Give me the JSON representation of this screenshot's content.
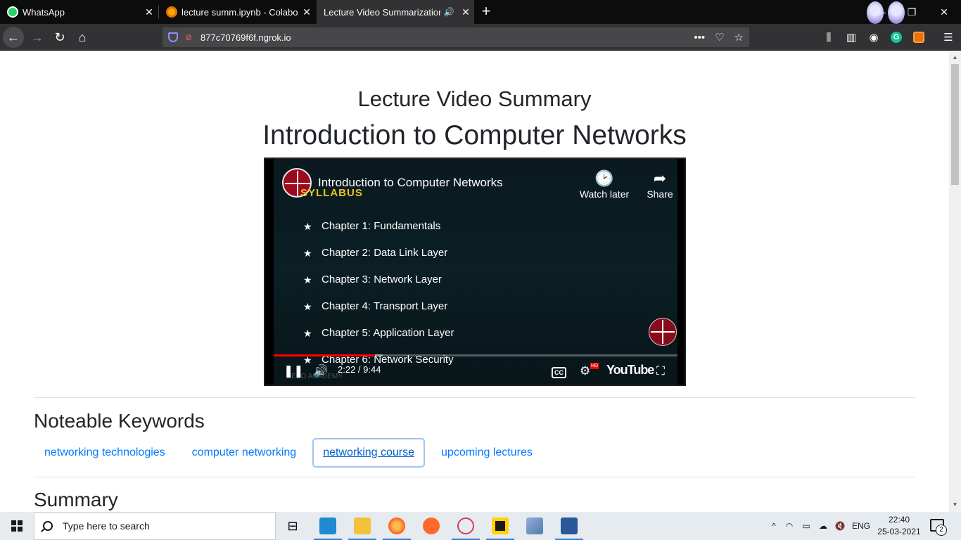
{
  "browser": {
    "tabs": [
      {
        "label": "WhatsApp",
        "icon": "whatsapp-icon"
      },
      {
        "label": "lecture summ.ipynb - Colabora",
        "icon": "colab-icon"
      },
      {
        "label": "Lecture Video Summarization",
        "icon": "speaker-icon",
        "active": true
      }
    ],
    "url": "877c70769f6f.ngrok.io"
  },
  "page": {
    "subtitle": "Lecture Video Summary",
    "title": "Introduction to Computer Networks",
    "video": {
      "title": "Introduction to Computer Networks",
      "watch_later": "Watch later",
      "share": "Share",
      "syllabus": "SYLLABUS",
      "chapters": [
        "Chapter 1:  Fundamentals",
        "Chapter 2: Data Link Layer",
        "Chapter 3: Network Layer",
        "Chapter 4: Transport Layer",
        "Chapter 5: Application Layer",
        "Chapter 6: Network Security"
      ],
      "time": "2:22 / 9:44",
      "progress": 0.251,
      "buffered": 0.27,
      "platform": "YouTube",
      "cc": "CC",
      "hd_badge": "HD",
      "watermark": "NESO ACADEMY"
    },
    "keywords_heading": "Noteable Keywords",
    "keywords": [
      "networking technologies",
      "computer networking",
      "networking course",
      "upcoming lectures"
    ],
    "summary_heading": "Summary"
  },
  "taskbar": {
    "search_placeholder": "Type here to search",
    "language": "ENG",
    "time": "22:40",
    "date": "25-03-2021",
    "notifications": "2"
  },
  "colors": {
    "link": "#007bff",
    "progress": "#ff0000",
    "brand_red": "#9c0a1c"
  }
}
